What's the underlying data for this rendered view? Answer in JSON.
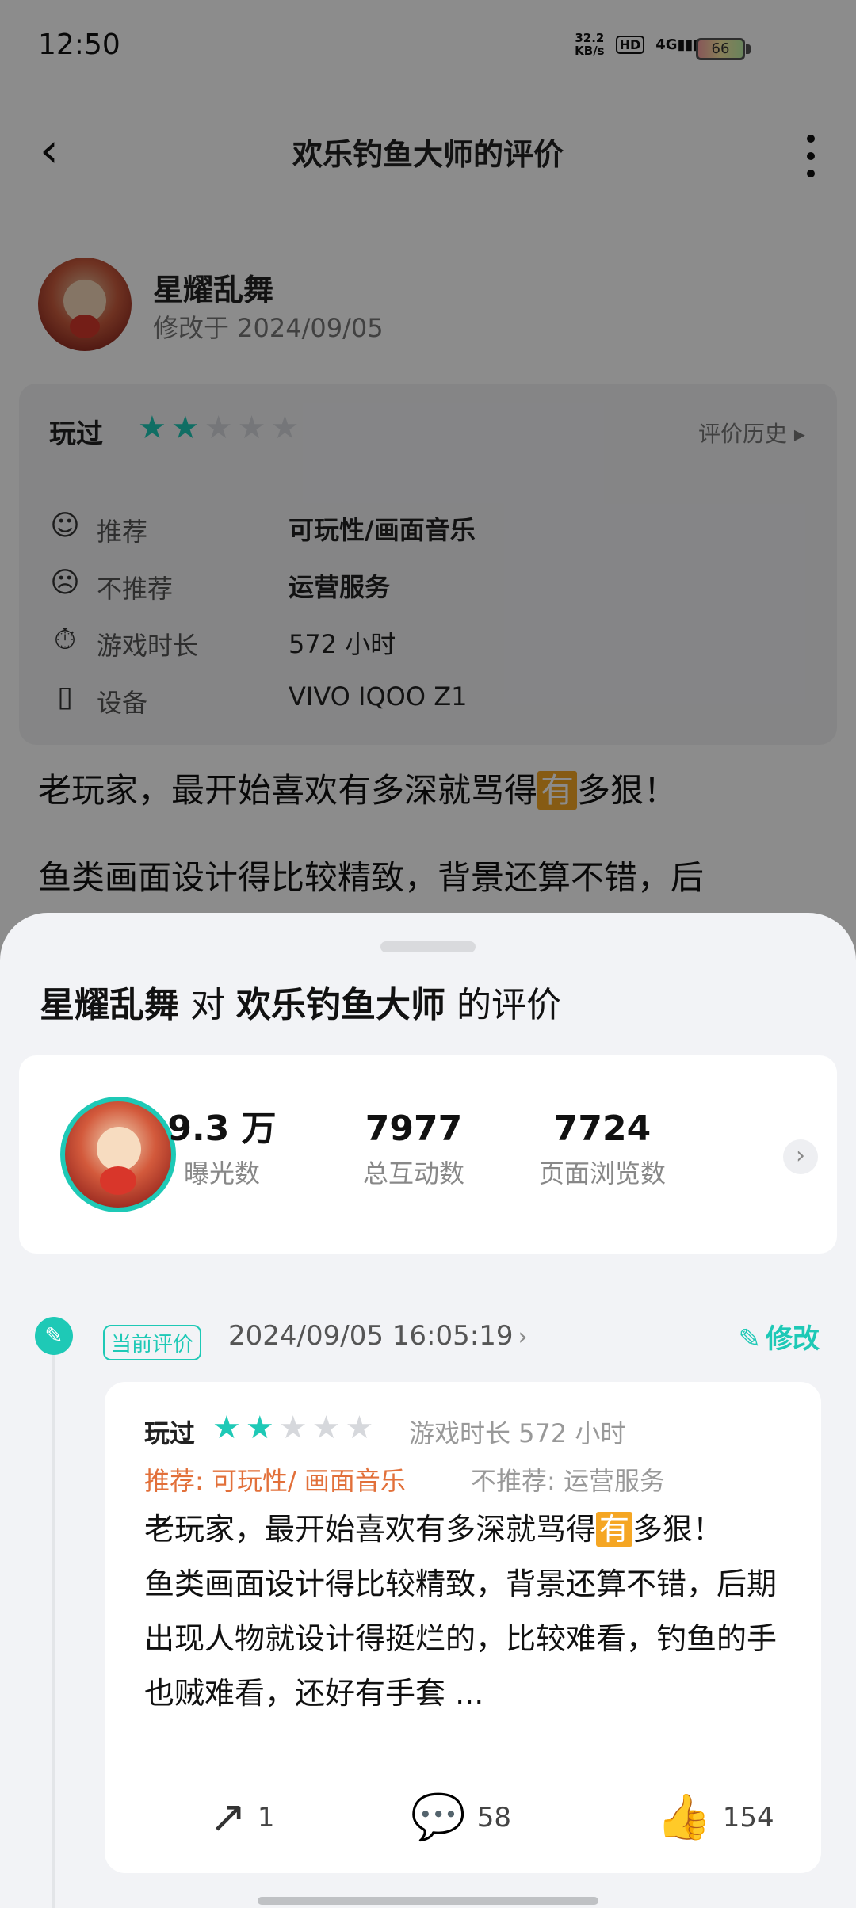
{
  "status_bar": {
    "time": "12:50",
    "net_speed_value": "32.2",
    "net_speed_unit": "KB/s",
    "hd": "HD",
    "signal": "4G",
    "battery": "66"
  },
  "nav": {
    "back": "‹",
    "title": "欢乐钓鱼大师的评价"
  },
  "author": {
    "name": "星耀乱舞",
    "modified": "修改于 2024/09/05"
  },
  "info_card": {
    "played_label": "玩过",
    "rating": 2,
    "max_rating": 5,
    "history_label": "评价历史 ▸",
    "rows": [
      {
        "icon": "☺",
        "label": "推荐",
        "value": "可玩性/画面音乐"
      },
      {
        "icon": "☹",
        "label": "不推荐",
        "value": "运营服务"
      },
      {
        "icon": "⏱",
        "label": "游戏时长",
        "value": "572 小时"
      },
      {
        "icon": "▯",
        "label": "设备",
        "value": "VIVO IQOO Z1"
      }
    ]
  },
  "review_preview": {
    "line1_pre": "老玩家，最开始喜欢有多深就骂得",
    "line1_hl": "有",
    "line1_post": "多狠！",
    "line2": "鱼类画面设计得比较精致，背景还算不错，后"
  },
  "sheet": {
    "title_user": "星耀乱舞",
    "title_mid": " 对 ",
    "title_game": "欢乐钓鱼大师",
    "title_suffix": " 的评价",
    "stats": [
      {
        "num": "9.3 万",
        "label": "曝光数"
      },
      {
        "num": "7977",
        "label": "总互动数"
      },
      {
        "num": "7724",
        "label": "页面浏览数"
      }
    ],
    "current_tag": "当前评价",
    "current_date": "2024/09/05 16:05:19",
    "modify_label": "修改",
    "card": {
      "played_label": "玩过",
      "rating": 2,
      "duration": "游戏时长 572 小时",
      "recommend": "推荐: 可玩性/ 画面音乐",
      "not_recommend": "不推荐: 运营服务",
      "text_pre": "老玩家，最开始喜欢有多深就骂得",
      "text_hl": "有",
      "text_post": "多狠！",
      "text_rest": "鱼类画面设计得比较精致，背景还算不错，后期出现人物就设计得挺烂的，比较难看，钓鱼的手也贼难看，还好有手套 ..."
    },
    "actions": {
      "share_count": "1",
      "comment_count": "58",
      "like_count": "154"
    }
  },
  "colors": {
    "accent": "#1ec9b6",
    "recommend": "#e2703a",
    "highlight": "#f5a623"
  }
}
